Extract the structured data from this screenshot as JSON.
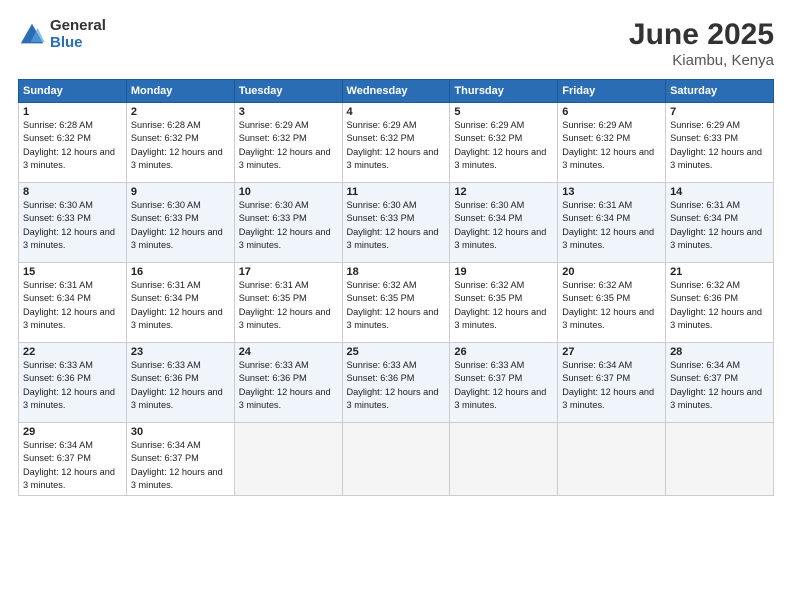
{
  "logo": {
    "general": "General",
    "blue": "Blue"
  },
  "title": "June 2025",
  "location": "Kiambu, Kenya",
  "days_of_week": [
    "Sunday",
    "Monday",
    "Tuesday",
    "Wednesday",
    "Thursday",
    "Friday",
    "Saturday"
  ],
  "weeks": [
    [
      {
        "day": "1",
        "sunrise": "6:28 AM",
        "sunset": "6:32 PM",
        "daylight": "12 hours and 3 minutes."
      },
      {
        "day": "2",
        "sunrise": "6:28 AM",
        "sunset": "6:32 PM",
        "daylight": "12 hours and 3 minutes."
      },
      {
        "day": "3",
        "sunrise": "6:29 AM",
        "sunset": "6:32 PM",
        "daylight": "12 hours and 3 minutes."
      },
      {
        "day": "4",
        "sunrise": "6:29 AM",
        "sunset": "6:32 PM",
        "daylight": "12 hours and 3 minutes."
      },
      {
        "day": "5",
        "sunrise": "6:29 AM",
        "sunset": "6:32 PM",
        "daylight": "12 hours and 3 minutes."
      },
      {
        "day": "6",
        "sunrise": "6:29 AM",
        "sunset": "6:32 PM",
        "daylight": "12 hours and 3 minutes."
      },
      {
        "day": "7",
        "sunrise": "6:29 AM",
        "sunset": "6:33 PM",
        "daylight": "12 hours and 3 minutes."
      }
    ],
    [
      {
        "day": "8",
        "sunrise": "6:30 AM",
        "sunset": "6:33 PM",
        "daylight": "12 hours and 3 minutes."
      },
      {
        "day": "9",
        "sunrise": "6:30 AM",
        "sunset": "6:33 PM",
        "daylight": "12 hours and 3 minutes."
      },
      {
        "day": "10",
        "sunrise": "6:30 AM",
        "sunset": "6:33 PM",
        "daylight": "12 hours and 3 minutes."
      },
      {
        "day": "11",
        "sunrise": "6:30 AM",
        "sunset": "6:33 PM",
        "daylight": "12 hours and 3 minutes."
      },
      {
        "day": "12",
        "sunrise": "6:30 AM",
        "sunset": "6:34 PM",
        "daylight": "12 hours and 3 minutes."
      },
      {
        "day": "13",
        "sunrise": "6:31 AM",
        "sunset": "6:34 PM",
        "daylight": "12 hours and 3 minutes."
      },
      {
        "day": "14",
        "sunrise": "6:31 AM",
        "sunset": "6:34 PM",
        "daylight": "12 hours and 3 minutes."
      }
    ],
    [
      {
        "day": "15",
        "sunrise": "6:31 AM",
        "sunset": "6:34 PM",
        "daylight": "12 hours and 3 minutes."
      },
      {
        "day": "16",
        "sunrise": "6:31 AM",
        "sunset": "6:34 PM",
        "daylight": "12 hours and 3 minutes."
      },
      {
        "day": "17",
        "sunrise": "6:31 AM",
        "sunset": "6:35 PM",
        "daylight": "12 hours and 3 minutes."
      },
      {
        "day": "18",
        "sunrise": "6:32 AM",
        "sunset": "6:35 PM",
        "daylight": "12 hours and 3 minutes."
      },
      {
        "day": "19",
        "sunrise": "6:32 AM",
        "sunset": "6:35 PM",
        "daylight": "12 hours and 3 minutes."
      },
      {
        "day": "20",
        "sunrise": "6:32 AM",
        "sunset": "6:35 PM",
        "daylight": "12 hours and 3 minutes."
      },
      {
        "day": "21",
        "sunrise": "6:32 AM",
        "sunset": "6:36 PM",
        "daylight": "12 hours and 3 minutes."
      }
    ],
    [
      {
        "day": "22",
        "sunrise": "6:33 AM",
        "sunset": "6:36 PM",
        "daylight": "12 hours and 3 minutes."
      },
      {
        "day": "23",
        "sunrise": "6:33 AM",
        "sunset": "6:36 PM",
        "daylight": "12 hours and 3 minutes."
      },
      {
        "day": "24",
        "sunrise": "6:33 AM",
        "sunset": "6:36 PM",
        "daylight": "12 hours and 3 minutes."
      },
      {
        "day": "25",
        "sunrise": "6:33 AM",
        "sunset": "6:36 PM",
        "daylight": "12 hours and 3 minutes."
      },
      {
        "day": "26",
        "sunrise": "6:33 AM",
        "sunset": "6:37 PM",
        "daylight": "12 hours and 3 minutes."
      },
      {
        "day": "27",
        "sunrise": "6:34 AM",
        "sunset": "6:37 PM",
        "daylight": "12 hours and 3 minutes."
      },
      {
        "day": "28",
        "sunrise": "6:34 AM",
        "sunset": "6:37 PM",
        "daylight": "12 hours and 3 minutes."
      }
    ],
    [
      {
        "day": "29",
        "sunrise": "6:34 AM",
        "sunset": "6:37 PM",
        "daylight": "12 hours and 3 minutes."
      },
      {
        "day": "30",
        "sunrise": "6:34 AM",
        "sunset": "6:37 PM",
        "daylight": "12 hours and 3 minutes."
      },
      null,
      null,
      null,
      null,
      null
    ]
  ]
}
